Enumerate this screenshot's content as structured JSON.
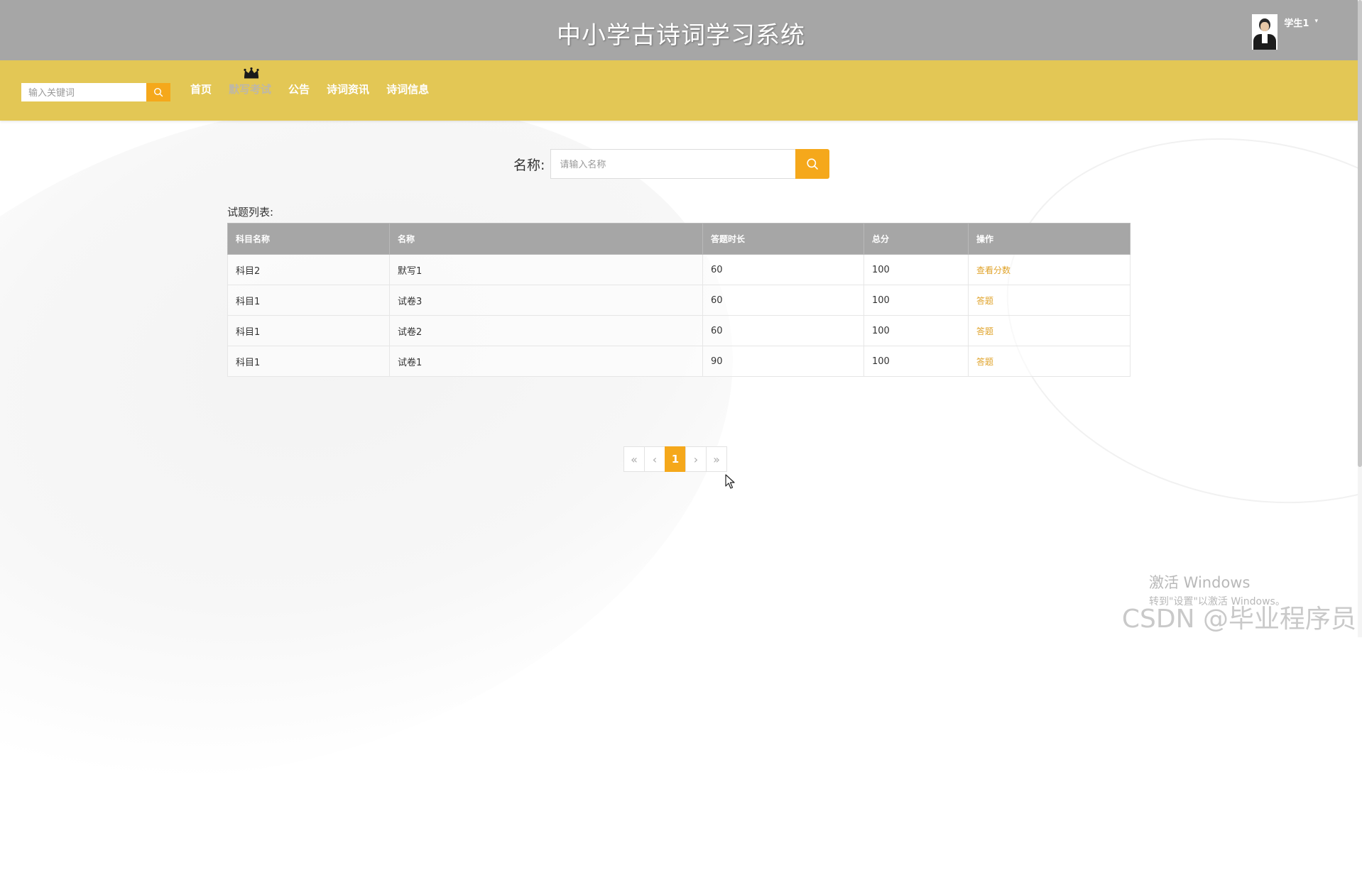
{
  "header": {
    "site_title": "中小学古诗词学习系统",
    "username": "学生1",
    "caret": "▾"
  },
  "nav": {
    "search_placeholder": "输入关键词",
    "items": [
      {
        "label": "首页",
        "active": false
      },
      {
        "label": "默写考试",
        "active": true
      },
      {
        "label": "公告",
        "active": false
      },
      {
        "label": "诗词资讯",
        "active": false
      },
      {
        "label": "诗词信息",
        "active": false
      }
    ]
  },
  "filter": {
    "label": "名称:",
    "placeholder": "请输入名称"
  },
  "list": {
    "title": "试题列表:",
    "columns": [
      "科目名称",
      "名称",
      "答题时长",
      "总分",
      "操作"
    ],
    "rows": [
      {
        "subject": "科目2",
        "name": "默写1",
        "duration": "60",
        "score": "100",
        "action": "查看分数"
      },
      {
        "subject": "科目1",
        "name": "试卷3",
        "duration": "60",
        "score": "100",
        "action": "答题"
      },
      {
        "subject": "科目1",
        "name": "试卷2",
        "duration": "60",
        "score": "100",
        "action": "答题"
      },
      {
        "subject": "科目1",
        "name": "试卷1",
        "duration": "90",
        "score": "100",
        "action": "答题"
      }
    ]
  },
  "pagination": {
    "first": "«",
    "prev": "‹",
    "current": "1",
    "next": "›",
    "last": "»"
  },
  "watermark": {
    "windows_line1": "激活 Windows",
    "windows_line2": "转到\"设置\"以激活 Windows。",
    "csdn": "CSDN @毕业程序员"
  },
  "icons": {
    "search": "search-icon",
    "crown": "crown-icon",
    "caret": "chevron-down-icon",
    "cursor": "mouse-cursor-icon"
  },
  "colors": {
    "header_bg": "#a6a6a6",
    "nav_bg": "#e3c755",
    "accent": "#f5a81b",
    "link": "#e0a32a",
    "table_header": "#a6a6a6"
  }
}
